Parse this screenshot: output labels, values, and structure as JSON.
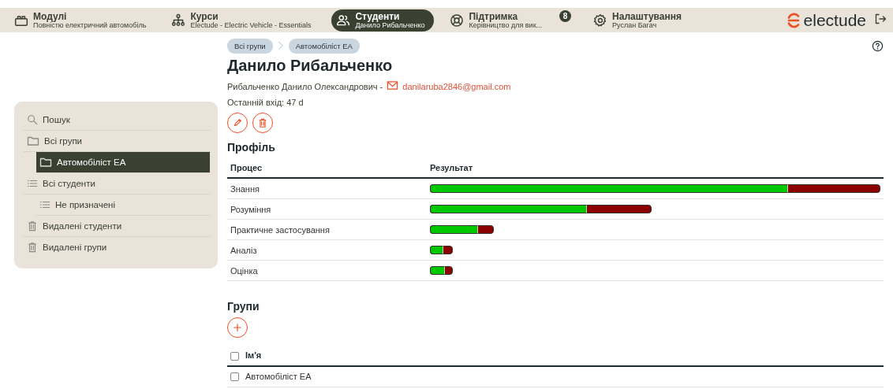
{
  "nav": {
    "items": [
      {
        "kind": "modules",
        "title": "Модулі",
        "subtitle": "Повністю електричний автомобіль",
        "selected": false
      },
      {
        "kind": "courses",
        "title": "Курси",
        "subtitle": "Electude - Electric Vehicle - Essentials",
        "selected": false
      },
      {
        "kind": "students",
        "title": "Студенти",
        "subtitle": "Данило Рибальченко",
        "selected": true
      },
      {
        "kind": "support",
        "title": "Підтримка",
        "subtitle": "Керівництво для вик...",
        "selected": false,
        "badge": "8"
      },
      {
        "kind": "settings",
        "title": "Налаштування",
        "subtitle": "Руслан Багач",
        "selected": false
      }
    ],
    "logo": "electude"
  },
  "sidebar": {
    "items": [
      {
        "kind": "search",
        "label": "Пошук",
        "selected": false
      },
      {
        "kind": "folder",
        "label": "Всі групи",
        "selected": false,
        "children": [
          {
            "kind": "folder",
            "label": "Автомобіліст ЕА",
            "selected": true
          }
        ]
      },
      {
        "kind": "list",
        "label": "Всі студенти",
        "selected": false,
        "children": [
          {
            "kind": "list",
            "label": "Не призначені",
            "selected": false
          }
        ]
      },
      {
        "kind": "trash",
        "label": "Видалені студенти",
        "selected": false
      },
      {
        "kind": "trash",
        "label": "Видалені групи",
        "selected": false
      }
    ]
  },
  "breadcrumbs": [
    "Всі групи",
    "Автомобіліст ЕА"
  ],
  "student": {
    "name": "Данило Рибальченко",
    "full_name": "Рибальченко Данило Олександрович -",
    "email": "danilaruba2846@gmail.com",
    "last_login": "Останній вхід: 47 d"
  },
  "profile": {
    "title": "Профіль",
    "columns": [
      "Процес",
      "Результат"
    ],
    "rows": [
      {
        "process": "Знання",
        "level": 1.0,
        "correct": {
          "level": 0.795
        }
      },
      {
        "process": "Розуміння",
        "level": 0.492,
        "correct": {
          "level": 0.348
        }
      },
      {
        "process": "Практичне застосування",
        "level": 0.141,
        "correct": {
          "level": 0.106
        }
      },
      {
        "process": "Аналіз",
        "level": 0.05,
        "correct": {
          "level": 0.03
        }
      },
      {
        "process": "Оцінка",
        "level": 0.05,
        "correct": {
          "level": 0.033
        }
      }
    ]
  },
  "groups": {
    "title": "Групи",
    "column": "Ім'я",
    "header_checked": false,
    "rows": [
      {
        "name": "Автомобіліст ЕА",
        "checked": false
      }
    ]
  }
}
